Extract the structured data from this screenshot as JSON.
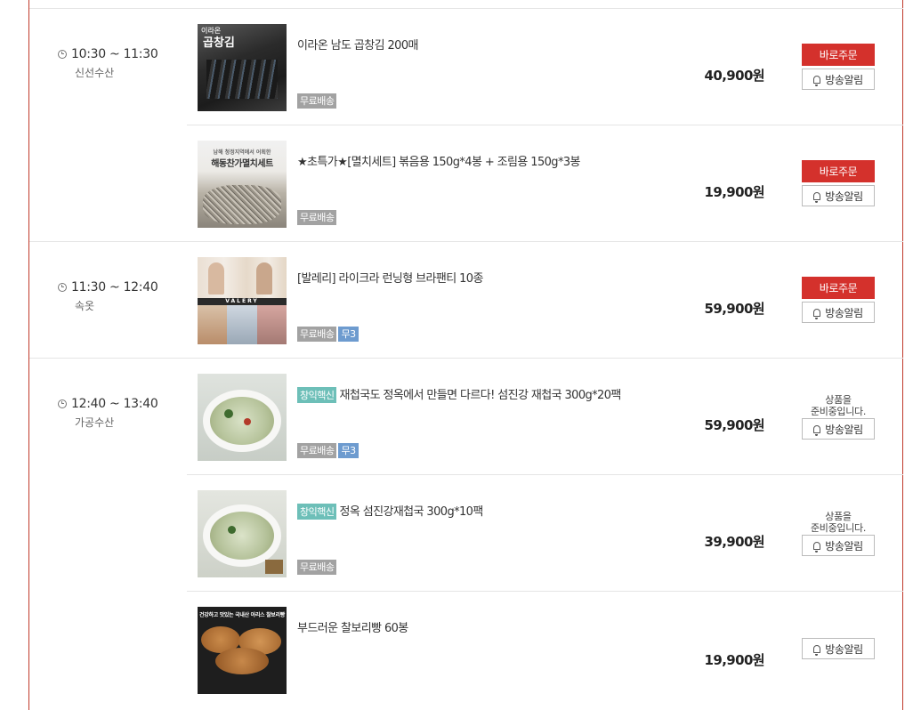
{
  "actions": {
    "order_label": "바로주문",
    "alarm_label": "방송알림",
    "preparing_line1": "상품을",
    "preparing_line2": "준비중입니다."
  },
  "slots": [
    {
      "time": "10:30 ~ 11:30",
      "category": "신선수산"
    },
    {
      "time": "11:30 ~ 12:40",
      "category": "속옷"
    },
    {
      "time": "12:40 ~ 13:40",
      "category": "가공수산"
    }
  ],
  "items": [
    {
      "name": "이라온 남도 곱창김 200매",
      "price": "40,900원",
      "badges": [
        "무료배송"
      ],
      "thumb_text": "곱창김",
      "thumb_small": "이라온"
    },
    {
      "name": "★초특가★[멸치세트] 볶음용 150g*4봉 + 조림용 150g*3봉",
      "price": "19,900원",
      "badges": [
        "무료배송"
      ],
      "thumb_text": "해동찬가멸치세트",
      "thumb_small": "남해 청정지역에서 어획한"
    },
    {
      "name": "[발레리] 라이크라 런닝형 브라팬티 10종",
      "price": "59,900원",
      "badges": [
        "무료배송",
        "무3"
      ],
      "thumb_text": "VALERY"
    },
    {
      "brand": "창익핵신",
      "name": "재첩국도 정옥에서 만들면 다르다! 섬진강 재첩국 300g*20팩",
      "price": "59,900원",
      "badges": [
        "무료배송",
        "무3"
      ]
    },
    {
      "brand": "창익핵신",
      "name": "정옥 섬진강재첩국 300g*10팩",
      "price": "39,900원",
      "badges": [
        "무료배송"
      ]
    },
    {
      "name": "부드러운 찰보리빵 60봉",
      "price": "19,900원",
      "badges": [],
      "thumb_small": "건강하고 맛있는 국내산 아리스 찰보리빵"
    }
  ],
  "colors": {
    "accent": "#d4312c",
    "border": "#c0392b",
    "brand_tag": "#6dbfb8",
    "badge_gray": "#a2a2a2",
    "badge_blue": "#6d9bcf"
  }
}
